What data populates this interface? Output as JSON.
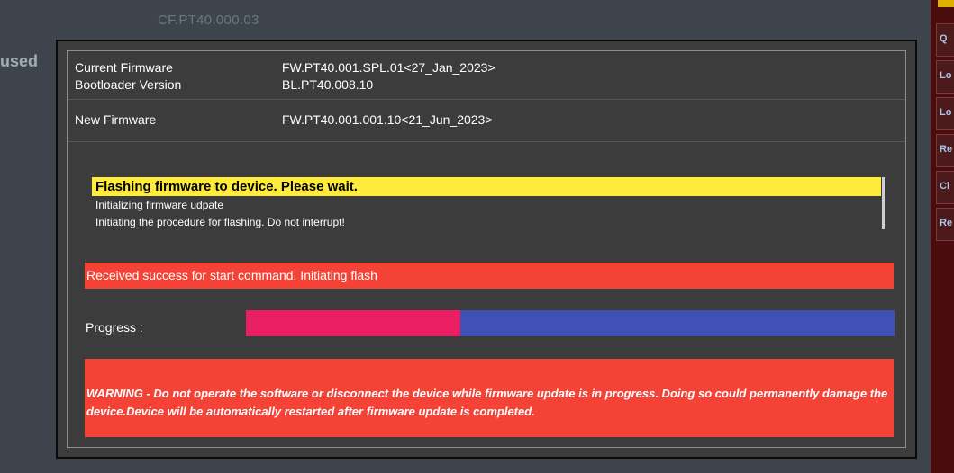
{
  "background": {
    "config_label": "CF.PT40.000.03",
    "partial_text": "used",
    "side_tabs": [
      "Q",
      "Lo",
      "Lo",
      "Re",
      "Cl",
      "Re"
    ]
  },
  "dialog": {
    "current_firmware": {
      "label": "Current Firmware",
      "value": "FW.PT40.001.SPL.01<27_Jan_2023>"
    },
    "bootloader": {
      "label": "Bootloader Version",
      "value": "BL.PT40.008.10"
    },
    "new_firmware": {
      "label": "New Firmware",
      "value": "FW.PT40.001.001.10<21_Jun_2023>"
    },
    "log": {
      "title": "Flashing firmware to device. Please wait.",
      "lines": [
        "Initializing firmware udpate",
        "Initiating the procedure for flashing. Do not interrupt!"
      ]
    },
    "status_message": "Received success for start command. Initiating flash",
    "progress": {
      "label": "Progress :",
      "fraction": 0.33
    },
    "warning": "WARNING - Do not operate the software or disconnect the device while firmware update is in progress. Doing so could permanently damage the device.Device will be automatically restarted after firmware update is completed."
  },
  "colors": {
    "app_background": "#3d444b",
    "dialog_background": "#3c3c3c",
    "highlight": "#ffeb3b",
    "status_red": "#f44336",
    "progress_fill": "#e91e63",
    "progress_track": "#3f51b5"
  }
}
